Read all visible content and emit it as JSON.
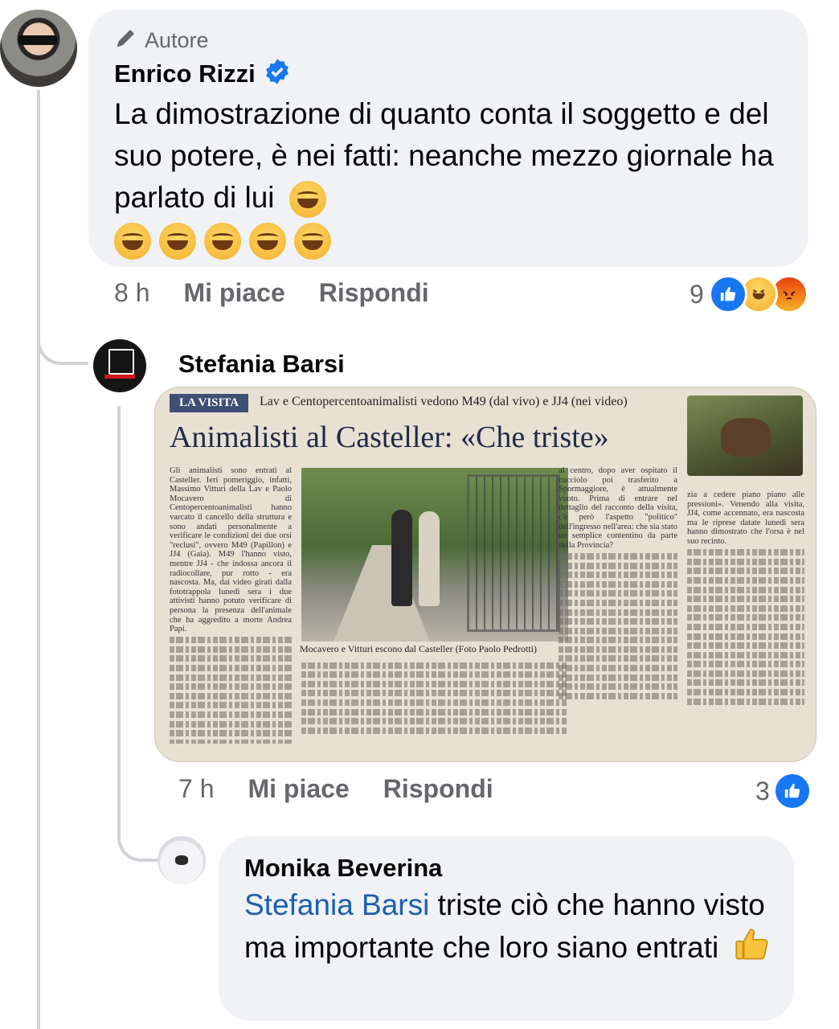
{
  "comments": [
    {
      "author_badge": "Autore",
      "author": "Enrico Rizzi",
      "text": "La dimostrazione di quanto conta il soggetto e del suo potere, è nei fatti: neanche mezzo giornale ha parlato di lui",
      "time": "8 h",
      "like_label": "Mi piace",
      "reply_label": "Rispondi",
      "reaction_count": "9",
      "reactions": [
        "like",
        "haha",
        "angry"
      ]
    },
    {
      "author": "Stefania Barsi",
      "time": "7 h",
      "like_label": "Mi piace",
      "reply_label": "Rispondi",
      "reaction_count": "3",
      "reactions": [
        "like"
      ],
      "attachment": {
        "kicker": "LA VISITA",
        "subheadline": "Lav e Centopercentoanimalisti vedono M49 (dal vivo) e JJ4 (nei video)",
        "headline": "Animalisti al Casteller: «Che triste»",
        "photo_caption": "Mocavero e Vitturi escono dal Casteller (Foto Paolo Pedrotti)",
        "col1": "Gli animalisti sono entrati al Casteller. Ieri pomeriggio, infatti, Massimo Vitturi della Lav e Paolo Mocavero di Centopercentoanimalisti hanno varcato il cancello della struttura e sono andati personalmente a verificare le condizioni dei due orsi \"reclusi\", ovvero M49 (Papillon) e JJ4 (Gaia). M49 l'hanno visto, mentre JJ4 - che indossa ancora il radiocollare, pur rotto - era nascosta. Ma, dai video girati dalla fototrappola lunedì sera i due attivisti hanno potuto verificare di persona la presenza dell'animale che ha aggredito a morte Andrea Papi.",
        "col2": "al centro, dopo aver ospitato il cucciolo poi trasferito a Spormaggiore, è attualmente vuoto. Prima di entrare nel dettaglio del racconto della visita, c'è però l'aspetto \"politico\" dell'ingresso nell'area: che sia stato un semplice contentino da parte della Provincia?",
        "col3": "zia a cedere piano piano alle pressioni». Venendo alla visita, JJ4, come accennato, era nascosta ma le riprese datate lunedì sera hanno dimostrato che l'orsa è nel suo recinto."
      }
    },
    {
      "author": "Monika Beverina",
      "mention": "Stefania Barsi",
      "text": " triste ciò che hanno visto ma importante che loro siano entrati"
    }
  ],
  "colors": {
    "bubble": "#f0f2f5",
    "meta_text": "#65676b",
    "link": "#1a5fb4",
    "verified": "#1877f2",
    "like": "#1877f2",
    "angry": "#e9710f"
  },
  "icons": [
    "pencil-icon",
    "verified-badge-icon",
    "laughing-emoji",
    "like-reaction-icon",
    "haha-reaction-icon",
    "angry-reaction-icon",
    "thumbs-up-emoji"
  ]
}
